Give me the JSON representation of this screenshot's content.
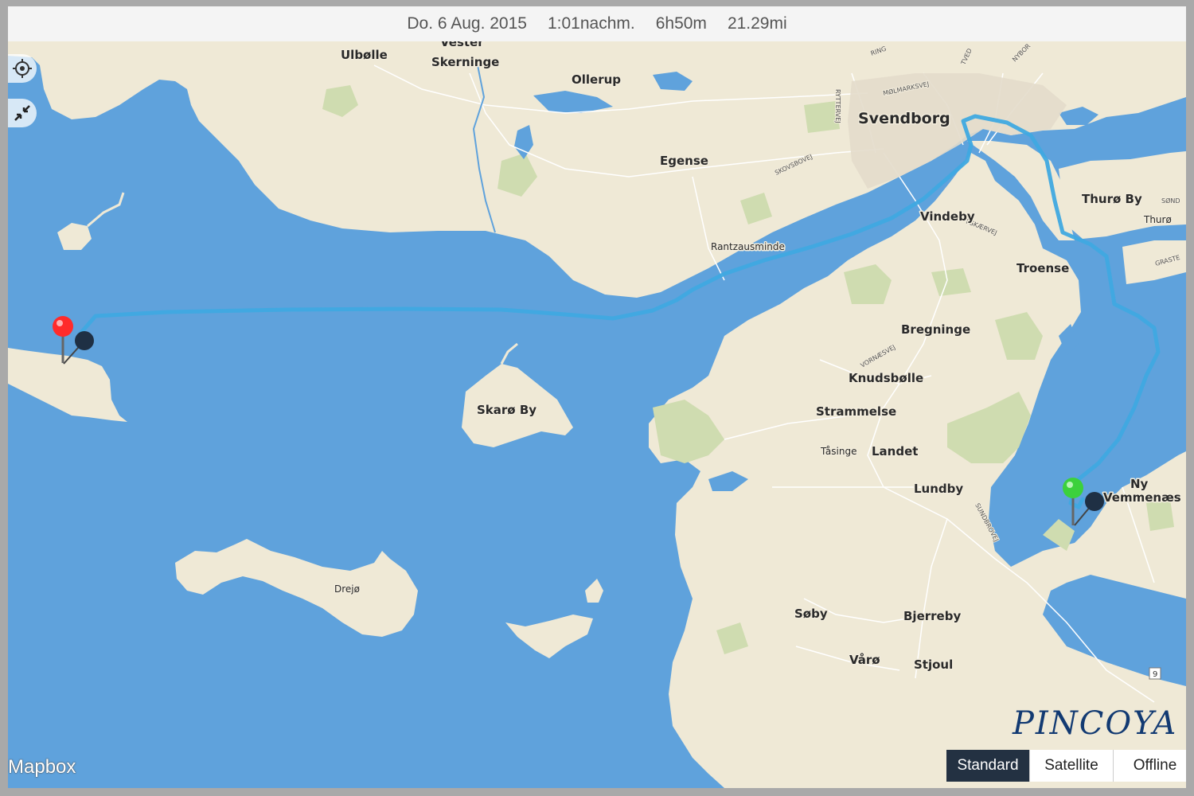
{
  "header": {
    "date": "Do. 6 Aug. 2015",
    "time": "1:01nachm.",
    "duration": "6h50m",
    "distance": "21.29mi"
  },
  "controls": {
    "locate_icon": "crosshair-icon",
    "collapse_icon": "collapse-arrows-icon"
  },
  "map": {
    "colors": {
      "water": "#5fa2dc",
      "land": "#efe9d6",
      "park": "#cfdcb0",
      "track": "#3fa9e0",
      "start_pin": "#ff2b2b",
      "end_pin": "#3cd13c"
    },
    "places": {
      "ulbolle": "Ulbølle",
      "vester": "Vester",
      "skerninge": "Skerninge",
      "ollerup": "Ollerup",
      "svendborg": "Svendborg",
      "egense": "Egense",
      "thuro_by": "Thurø By",
      "thuro": "Thurø",
      "sond": "SØND",
      "graste": "GRASTE",
      "vindeby": "Vindeby",
      "troense": "Troense",
      "rantzausminde": "Rantzausminde",
      "bregninge": "Bregninge",
      "knudsbolle": "Knudsbølle",
      "strammelse": "Strammelse",
      "skaro_by": "Skarø By",
      "tasinge": "Tåsinge",
      "landet": "Landet",
      "lundby": "Lundby",
      "ny": "Ny",
      "vemmenaes": "Vemmenæs",
      "drejo": "Drejø",
      "soby": "Søby",
      "bjerreby": "Bjerreby",
      "varo": "Vårø",
      "stjoul": "Stjoul"
    },
    "roads": {
      "ring": "RING",
      "tved": "TVED",
      "nybor": "NYBOR",
      "molmarksvej": "MØLMARKSVEJ",
      "rytterve": "RYTTERVEJ",
      "skovsbovej": "SKOVSBOVEJ",
      "eskaervej": "ESKÆRVEJ",
      "vornaesvej": "VORNÆSVEJ",
      "sundbrovej": "SUNDBROVEJ",
      "route_9": "9"
    }
  },
  "branding": "PINCOYA",
  "attribution": "Mapbox",
  "map_modes": [
    {
      "label": "Standard",
      "active": true
    },
    {
      "label": "Satellite",
      "active": false
    },
    {
      "label": "Offline",
      "active": false
    }
  ]
}
